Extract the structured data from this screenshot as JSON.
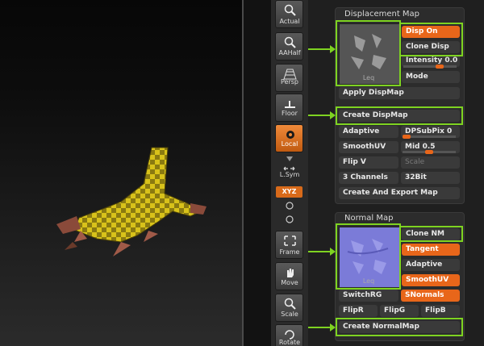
{
  "shelf": {
    "actual": "Actual",
    "aahalf": "AAHalf",
    "persp": "Persp",
    "floor": "Floor",
    "local": "Local",
    "lsym": "L.Sym",
    "xyz": "XYZ",
    "frame": "Frame",
    "move": "Move",
    "scale": "Scale",
    "rotate": "Rotate"
  },
  "displacement_map": {
    "title": "Displacement Map",
    "thumb_label": "Leq",
    "disp_on": "Disp On",
    "clone_disp": "Clone Disp",
    "intensity_label": "Intensity",
    "intensity_value": "0.0",
    "mode": "Mode",
    "apply": "Apply DispMap",
    "create": "Create DispMap",
    "adaptive": "Adaptive",
    "dpsubpix_label": "DPSubPix",
    "dpsubpix_value": "0",
    "smooth_uv": "SmoothUV",
    "mid_label": "Mid",
    "mid_value": "0.5",
    "flip_v": "Flip V",
    "scale": "Scale",
    "channels": "3 Channels",
    "bit": "32Bit",
    "create_export": "Create And Export Map"
  },
  "normal_map": {
    "title": "Normal Map",
    "thumb_label": "Leq",
    "clone_nm": "Clone NM",
    "tangent": "Tangent",
    "adaptive": "Adaptive",
    "smooth_uv": "SmoothUV",
    "switch_rg": "SwitchRG",
    "snormals": "SNormals",
    "flip_r": "FlipR",
    "flip_g": "FlipG",
    "flip_b": "FlipB",
    "create": "Create NormalMap"
  },
  "colors": {
    "accent": "#e8661a",
    "highlight": "#7ed321",
    "panel": "#2c2c2c"
  }
}
